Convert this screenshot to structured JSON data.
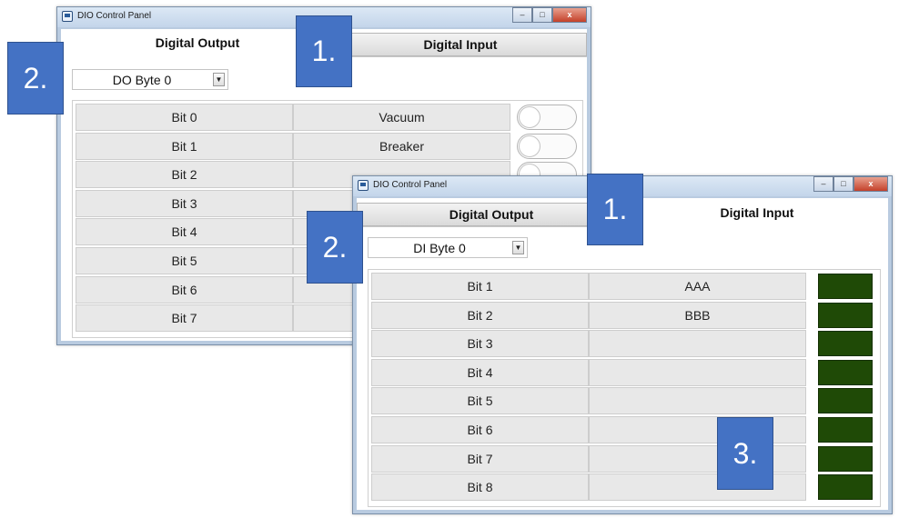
{
  "windows": {
    "back": {
      "title": "DIO Control Panel",
      "tabs": {
        "output": "Digital Output",
        "input": "Digital Input"
      },
      "byte_select": "DO Byte 0",
      "rows": [
        {
          "bit": "Bit 0",
          "name": "Vacuum"
        },
        {
          "bit": "Bit 1",
          "name": "Breaker"
        },
        {
          "bit": "Bit 2",
          "name": ""
        },
        {
          "bit": "Bit 3",
          "name": ""
        },
        {
          "bit": "Bit 4",
          "name": ""
        },
        {
          "bit": "Bit 5",
          "name": ""
        },
        {
          "bit": "Bit 6",
          "name": ""
        },
        {
          "bit": "Bit 7",
          "name": ""
        }
      ]
    },
    "front": {
      "title": "DIO Control Panel",
      "tabs": {
        "output": "Digital Output",
        "input": "Digital Input"
      },
      "byte_select": "DI Byte 0",
      "rows": [
        {
          "bit": "Bit 1",
          "name": "AAA"
        },
        {
          "bit": "Bit 2",
          "name": "BBB"
        },
        {
          "bit": "Bit 3",
          "name": ""
        },
        {
          "bit": "Bit 4",
          "name": ""
        },
        {
          "bit": "Bit 5",
          "name": ""
        },
        {
          "bit": "Bit 6",
          "name": ""
        },
        {
          "bit": "Bit 7",
          "name": ""
        },
        {
          "bit": "Bit 8",
          "name": ""
        }
      ]
    }
  },
  "callouts": {
    "tabs": "1.",
    "select": "2.",
    "indicators": "3."
  },
  "colors": {
    "indicator_on": "#1f4a06",
    "callout": "#4472c4"
  }
}
